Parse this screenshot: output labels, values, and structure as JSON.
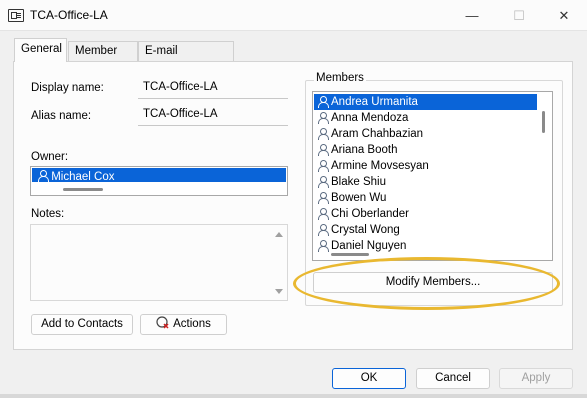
{
  "window": {
    "title": "TCA-Office-LA",
    "minimize_glyph": "—",
    "maximize_glyph": "☐",
    "close_glyph": "✕"
  },
  "tabs": [
    {
      "label": "General",
      "active": true
    },
    {
      "label": "Member Of",
      "active": false
    },
    {
      "label": "E-mail Addresses",
      "active": false
    }
  ],
  "general": {
    "display_name_label": "Display name:",
    "display_name_value": "TCA-Office-LA",
    "alias_name_label": "Alias name:",
    "alias_name_value": "TCA-Office-LA",
    "owner_label": "Owner:",
    "owner_value": "Michael Cox",
    "notes_label": "Notes:",
    "notes_value": "",
    "add_to_contacts_label": "Add to Contacts",
    "actions_label": "Actions"
  },
  "members": {
    "legend": "Members",
    "items": [
      "Andrea Urmanita",
      "Anna Mendoza",
      "Aram Chahbazian",
      "Ariana Booth",
      "Armine Movsesyan",
      "Blake Shiu",
      "Bowen Wu",
      "Chi Oberlander",
      "Crystal Wong",
      "Daniel Nguyen"
    ],
    "selected_index": 0,
    "modify_button_label": "Modify Members..."
  },
  "footer": {
    "ok_label": "OK",
    "cancel_label": "Cancel",
    "apply_label": "Apply"
  },
  "colors": {
    "selection": "#0a64d8",
    "highlight_ring": "#e9b830"
  }
}
